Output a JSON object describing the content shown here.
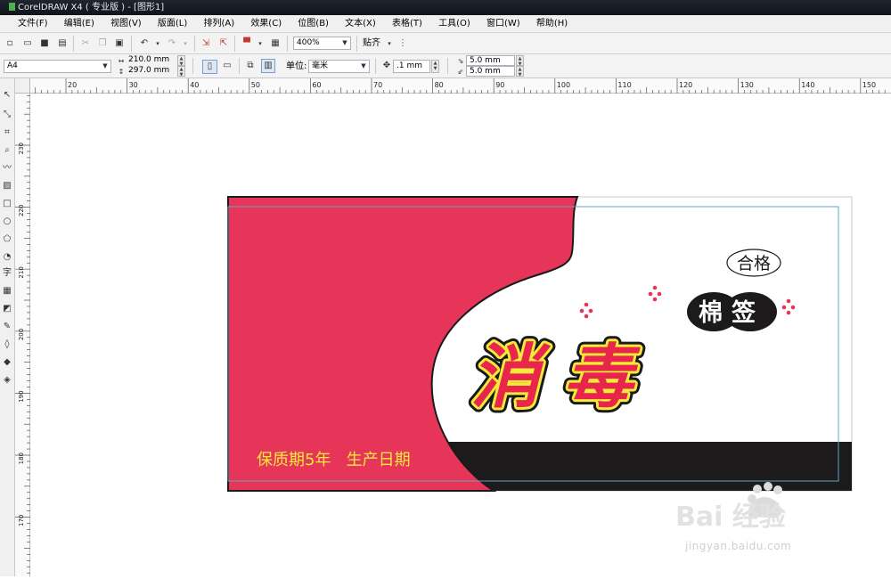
{
  "titlebar": {
    "title": "CorelDRAW X4 ( 专业版 ) - [图形1]"
  },
  "menu": [
    "文件(F)",
    "编辑(E)",
    "视图(V)",
    "版面(L)",
    "排列(A)",
    "效果(C)",
    "位图(B)",
    "文本(X)",
    "表格(T)",
    "工具(O)",
    "窗口(W)",
    "帮助(H)"
  ],
  "toolbar": {
    "zoom_value": "400%",
    "snap_label": "贴齐"
  },
  "property_bar": {
    "paper_size": "A4",
    "page_width": "210.0 mm",
    "page_height": "297.0 mm",
    "units_label": "单位:",
    "units_value": "毫米",
    "nudge_value": ".1 mm",
    "dup_x": "5.0 mm",
    "dup_y": "5.0 mm"
  },
  "ruler": {
    "h_ticks": [
      "20",
      "30",
      "40",
      "50",
      "60",
      "70",
      "80",
      "90",
      "100",
      "110",
      "120",
      "130",
      "140",
      "150"
    ],
    "v_ticks": [
      "230",
      "220",
      "210",
      "200",
      "190",
      "180",
      "170",
      "160"
    ]
  },
  "design": {
    "cert_label": "合格",
    "product_type": "棉签",
    "main_title": [
      "消",
      "毒"
    ],
    "footer_text": "保质期5年   生产日期",
    "colors": {
      "pink": "#e73559",
      "black": "#1c1a1a",
      "yellow": "#f5e93a",
      "text_red": "#e8264b"
    }
  },
  "watermark": {
    "logo_text": "Bai 经验",
    "url_text": "jingyan.baidu.com"
  }
}
